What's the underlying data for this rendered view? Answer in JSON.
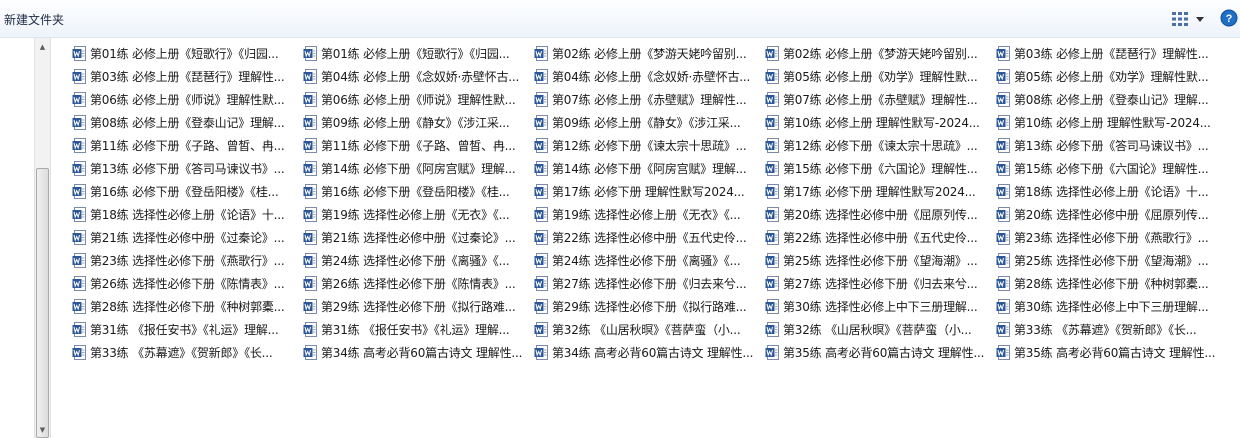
{
  "toolbar": {
    "new_folder_label": "新建文件夹",
    "colors": {
      "icon_blue": "#2b5797",
      "help_blue": "#1f6fc5"
    }
  },
  "file_icon": "word-document-icon",
  "files": [
    "第01练 必修上册《短歌行》《归园...",
    "第01练 必修上册《短歌行》《归园...",
    "第02练 必修上册《梦游天姥吟留别...",
    "第02练 必修上册《梦游天姥吟留别...",
    "第03练 必修上册《琵琶行》理解性...",
    "第03练 必修上册《琵琶行》理解性...",
    "第04练 必修上册《念奴娇·赤壁怀古...",
    "第04练 必修上册《念奴娇·赤壁怀古...",
    "第05练 必修上册《劝学》理解性默...",
    "第05练 必修上册《劝学》理解性默...",
    "第06练 必修上册《师说》理解性默...",
    "第06练 必修上册《师说》理解性默...",
    "第07练 必修上册《赤壁赋》理解性...",
    "第07练 必修上册《赤壁赋》理解性...",
    "第08练 必修上册《登泰山记》理解...",
    "第08练 必修上册《登泰山记》理解...",
    "第09练 必修上册《静女》《涉江采...",
    "第09练 必修上册《静女》《涉江采...",
    "第10练 必修上册 理解性默写-2024...",
    "第10练 必修上册 理解性默写-2024...",
    "第11练 必修下册《子路、曾皙、冉...",
    "第11练 必修下册《子路、曾皙、冉...",
    "第12练 必修下册《谏太宗十思疏》...",
    "第12练 必修下册《谏太宗十思疏》...",
    "第13练 必修下册《答司马谏议书》...",
    "第13练 必修下册《答司马谏议书》...",
    "第14练 必修下册《阿房宫赋》理解...",
    "第14练 必修下册《阿房宫赋》理解...",
    "第15练 必修下册《六国论》理解性...",
    "第15练 必修下册《六国论》理解性...",
    "第16练 必修下册《登岳阳楼》《桂...",
    "第16练 必修下册《登岳阳楼》《桂...",
    "第17练 必修下册 理解性默写2024...",
    "第17练 必修下册 理解性默写2024...",
    "第18练 选择性必修上册《论语》十...",
    "第18练 选择性必修上册《论语》十...",
    "第19练 选择性必修上册《无衣》《...",
    "第19练 选择性必修上册《无衣》《...",
    "第20练 选择性必修中册《屈原列传...",
    "第20练 选择性必修中册《屈原列传...",
    "第21练 选择性必修中册《过秦论》...",
    "第21练 选择性必修中册《过秦论》...",
    "第22练 选择性必修中册《五代史伶...",
    "第22练 选择性必修中册《五代史伶...",
    "第23练 选择性必修下册《燕歌行》...",
    "第23练 选择性必修下册《燕歌行》...",
    "第24练 选择性必修下册《离骚》《...",
    "第24练 选择性必修下册《离骚》《...",
    "第25练 选择性必修下册《望海潮》...",
    "第25练 选择性必修下册《望海潮》...",
    "第26练 选择性必修下册《陈情表》...",
    "第26练 选择性必修下册《陈情表》...",
    "第27练 选择性必修下册《归去来兮...",
    "第27练 选择性必修下册《归去来兮...",
    "第28练 选择性必修下册《种树郭橐...",
    "第28练 选择性必修下册《种树郭橐...",
    "第29练 选择性必修下册《拟行路难...",
    "第29练 选择性必修下册《拟行路难...",
    "第30练 选择性必修上中下三册理解...",
    "第30练 选择性必修上中下三册理解...",
    "第31练 《报任安书》《礼运》理解...",
    "第31练 《报任安书》《礼运》理解...",
    "第32练 《山居秋暝》《菩萨蛮（小...",
    "第32练 《山居秋暝》《菩萨蛮（小...",
    "第33练 《苏幕遮》《贺新郎》《长...",
    "第33练 《苏幕遮》《贺新郎》《长...",
    "第34练 高考必背60篇古诗文 理解性...",
    "第34练 高考必背60篇古诗文 理解性...",
    "第35练 高考必背60篇古诗文 理解性...",
    "第35练 高考必背60篇古诗文 理解性..."
  ]
}
